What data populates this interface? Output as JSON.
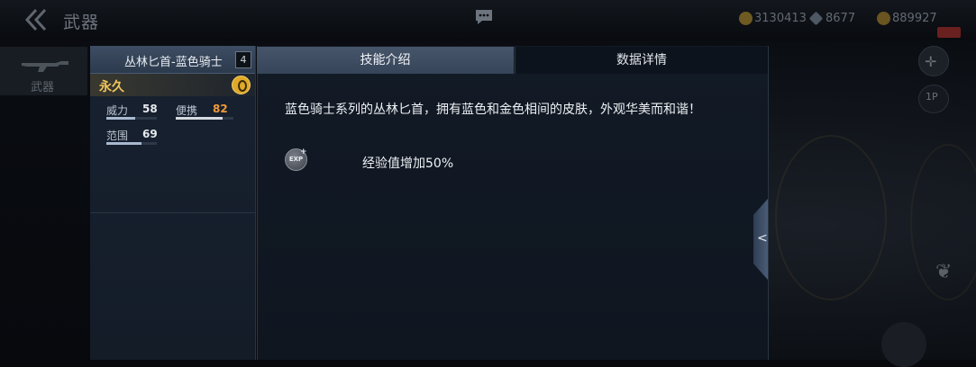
{
  "topbar": {
    "title": "武器",
    "currencies": [
      {
        "icon": "gold-coin-icon",
        "value": "3130413"
      },
      {
        "icon": "diamond-icon",
        "value": "8677"
      },
      {
        "icon": "coin-bag-icon",
        "value": "889927"
      }
    ]
  },
  "side_nav": {
    "items": [
      {
        "label": "武器",
        "icon": "rifle-icon"
      }
    ]
  },
  "weapon": {
    "name": "丛林匕首-蓝色骑士",
    "level": "4",
    "duration": "永久",
    "stats": [
      {
        "label": "威力",
        "value": "58",
        "fraction": 0.58,
        "value_color": "#e6e9ee"
      },
      {
        "label": "便携",
        "value": "82",
        "fraction": 0.82,
        "value_color": "#f39a3a"
      },
      {
        "label": "范围",
        "value": "69",
        "fraction": 0.69,
        "value_color": "#e6e9ee"
      }
    ]
  },
  "tabs": [
    {
      "label": "技能介绍",
      "active": true
    },
    {
      "label": "数据详情",
      "active": false
    }
  ],
  "content": {
    "description": "蓝色骑士系列的丛林匕首，拥有蓝色和金色相间的皮肤，外观华美而和谐！",
    "skill_icon_text": "EXP",
    "skill_text": "经验值增加50%"
  },
  "scene": {
    "mode_label": "1P"
  },
  "colors": {
    "accent_gold": "#f0c65a",
    "highlight_orange": "#f39a3a",
    "active_tab": "#46556a"
  }
}
